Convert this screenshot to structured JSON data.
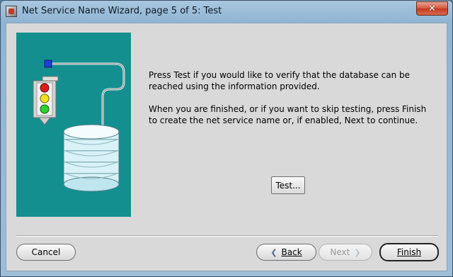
{
  "window": {
    "title": "Net Service Name Wizard, page 5 of 5: Test",
    "close_symbol": "✕"
  },
  "content": {
    "paragraph1": "Press Test if you would like to verify that the database can be reached using the information provided.",
    "paragraph2": "When you are finished, or if you want to skip testing, press Finish to create the net service name or, if enabled, Next to continue."
  },
  "buttons": {
    "test": "Test...",
    "cancel": "Cancel",
    "back": "Back",
    "next": "Next",
    "finish": "Finish"
  },
  "icons": {
    "app": "oracle-net-icon",
    "illustration": "traffic-light-database-illustration"
  },
  "colors": {
    "illustration_bg": "#138f8f",
    "dialog_bg": "#d9d9d9"
  }
}
